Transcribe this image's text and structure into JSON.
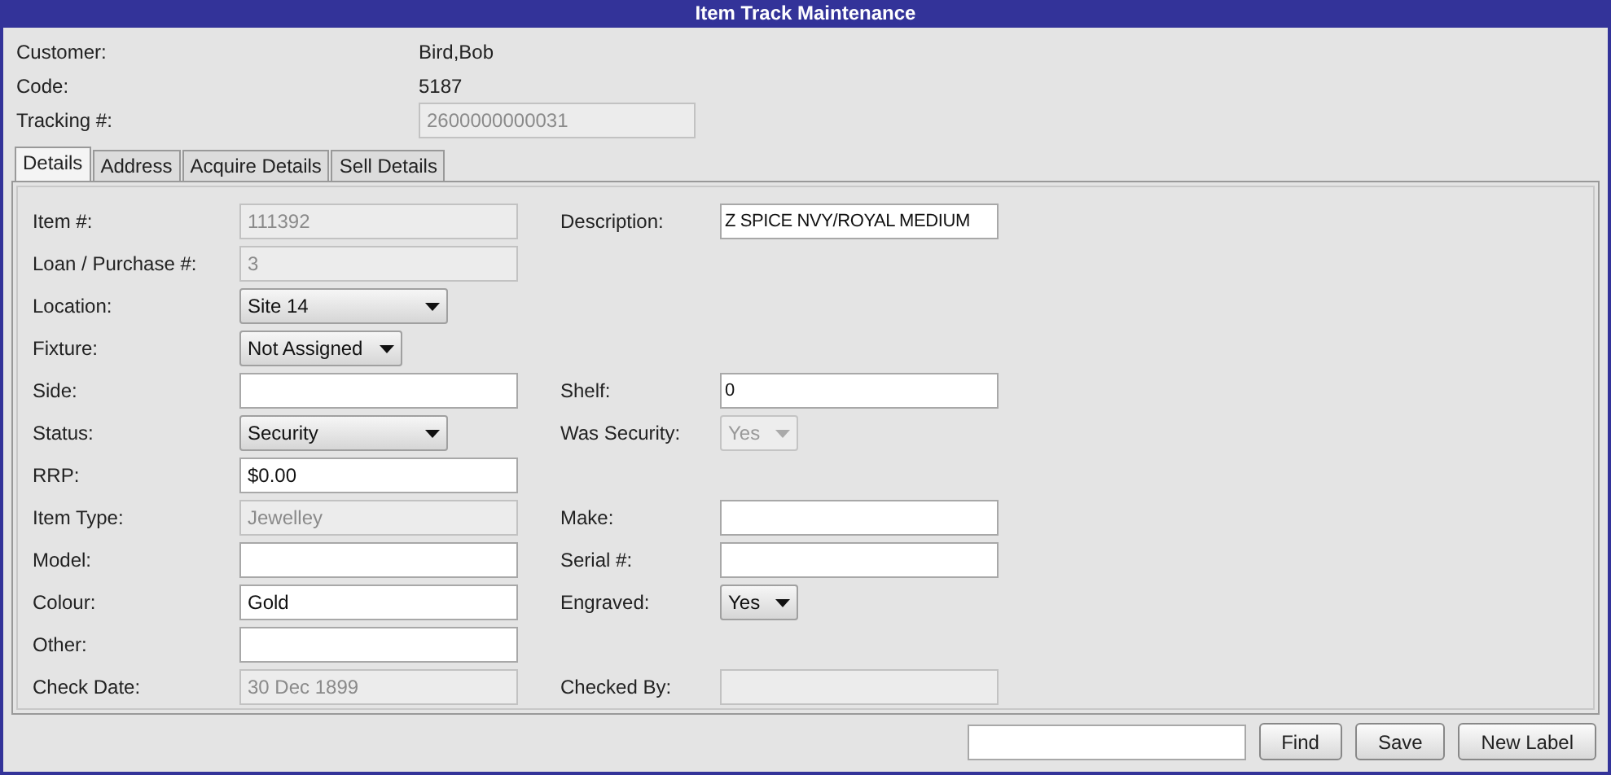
{
  "window": {
    "title": "Item Track Maintenance"
  },
  "header": [
    {
      "label": "Customer:",
      "kind": "text",
      "value": "Bird,Bob"
    },
    {
      "label": "Code:",
      "kind": "text",
      "value": "5187"
    },
    {
      "label": "Tracking #:",
      "kind": "field",
      "value": "2600000000031",
      "disabled": true
    }
  ],
  "tabs": [
    {
      "label": "Details",
      "selected": true
    },
    {
      "label": "Address",
      "selected": false
    },
    {
      "label": "Acquire Details",
      "selected": false
    },
    {
      "label": "Sell Details",
      "selected": false
    }
  ],
  "rows": [
    {
      "left": {
        "label": "Item #:",
        "kind": "field",
        "value": "111392",
        "disabled": true
      },
      "right": {
        "label": "Description:",
        "kind": "field",
        "value": "Z SPICE NVY/ROYAL MEDIUM",
        "disabled": false
      }
    },
    {
      "left": {
        "label": "Loan / Purchase #:",
        "kind": "field",
        "value": "3",
        "disabled": true
      }
    },
    {
      "left": {
        "label": "Location:",
        "kind": "select",
        "value": "Site 14",
        "disabled": false
      }
    },
    {
      "left": {
        "label": "Fixture:",
        "kind": "select",
        "value": "Not Assigned",
        "disabled": false
      }
    },
    {
      "left": {
        "label": "Side:",
        "kind": "field",
        "disabled": false
      },
      "right": {
        "label": "Shelf:",
        "kind": "field",
        "value": "0",
        "disabled": false
      }
    },
    {
      "left": {
        "label": "Status:",
        "kind": "select",
        "value": "Security",
        "disabled": false
      },
      "right": {
        "label": "Was Security:",
        "kind": "select",
        "value": "Yes",
        "disabled": true
      }
    },
    {
      "left": {
        "label": "RRP:",
        "kind": "field",
        "value": "$0.00",
        "disabled": false
      }
    },
    {
      "left": {
        "label": "Item Type:",
        "kind": "field",
        "value": "Jewelley",
        "disabled": true
      },
      "right": {
        "label": "Make:",
        "kind": "field",
        "disabled": false
      }
    },
    {
      "left": {
        "label": "Model:",
        "kind": "field",
        "disabled": false
      },
      "right": {
        "label": "Serial #:",
        "kind": "field",
        "disabled": false
      }
    },
    {
      "left": {
        "label": "Colour:",
        "kind": "field",
        "value": "Gold",
        "disabled": false
      },
      "right": {
        "label": "Engraved:",
        "kind": "select",
        "value": "Yes",
        "disabled": false
      }
    },
    {
      "left": {
        "label": "Other:",
        "kind": "field",
        "disabled": false
      }
    },
    {
      "left": {
        "label": "Check Date:",
        "kind": "field",
        "value": "30 Dec 1899",
        "disabled": true
      },
      "right": {
        "label": "Checked By:",
        "kind": "field",
        "disabled": true
      }
    }
  ],
  "buttons": [
    "Find",
    "Save",
    "New Label"
  ]
}
